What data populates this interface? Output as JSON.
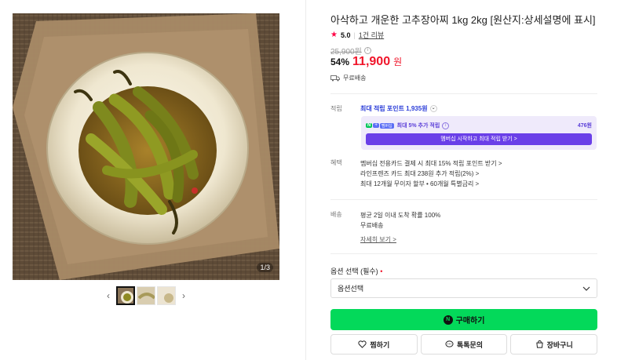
{
  "gallery": {
    "counter": "1/3",
    "prev_icon": "chevron-left-icon",
    "next_icon": "chevron-right-icon",
    "thumbnails": [
      "thumb-1",
      "thumb-2",
      "thumb-3"
    ]
  },
  "product": {
    "title": "아삭하고 개운한 고추장아찌 1kg 2kg [원산지:상세설명에 표시]",
    "rating": "5.0",
    "review_link": "1건 리뷰",
    "original_price": "25,900원",
    "discount": "54%",
    "sale_price": "11,900",
    "sale_unit": "원",
    "shipping_badge": "무료배송"
  },
  "points": {
    "label": "적립",
    "max_points": "최대 적립 포인트 1,935원",
    "member_badges": [
      "N",
      "+",
      "멤버십"
    ],
    "member_text": "최대 5% 추가 적립",
    "member_amount": "476원",
    "member_button": "멤버십 시작하고 최대 적립 받기 >"
  },
  "benefits": {
    "label": "혜택",
    "items": [
      "멤버십 전용카드 결제 시 최대 15% 적립 포인트 받기 >",
      "라인프렌즈 카드 최대 238원 추가 적립(2%) >",
      "최대 12개월 무이자 할부 • 60개월 특별금리 >"
    ]
  },
  "delivery": {
    "label": "배송",
    "line1": "평균 2일 이내 도착 확률 100%",
    "line2": "무료배송",
    "detail_link": "자세히 보기 >"
  },
  "option": {
    "label": "옵션 선택 (필수)",
    "required_mark": "•",
    "selected": "옵션선택"
  },
  "actions": {
    "buy": "구매하기",
    "buy_icon_text": "N",
    "wish": "찜하기",
    "talk": "톡톡문의",
    "cart": "장바구니"
  },
  "colors": {
    "sale_red": "#f0152a",
    "buy_green": "#03d95a",
    "member_purple": "#6a3fe8",
    "points_blue": "#2a3cd8"
  }
}
